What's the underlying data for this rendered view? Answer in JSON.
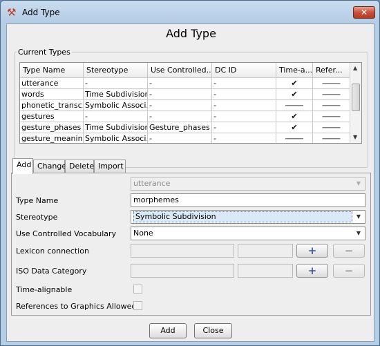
{
  "window": {
    "title": "Add Type",
    "close_glyph": "✕"
  },
  "dialog": {
    "heading": "Add Type"
  },
  "current_types": {
    "group_label": "Current Types",
    "columns": [
      "Type Name",
      "Stereotype",
      "Use Controlled...",
      "DC ID",
      "Time-a...",
      "Refer..."
    ],
    "rows": [
      [
        "utterance",
        "-",
        "-",
        "-",
        "✔",
        "⸻"
      ],
      [
        "words",
        "Time Subdivision",
        "-",
        "-",
        "✔",
        "⸻"
      ],
      [
        "phonetic_transc...",
        "Symbolic Associ...",
        "-",
        "-",
        "⸻",
        "⸻"
      ],
      [
        "gestures",
        "-",
        "-",
        "-",
        "✔",
        "⸻"
      ],
      [
        "gesture_phases",
        "Time Subdivision",
        "Gesture_phases",
        "-",
        "✔",
        "⸻"
      ],
      [
        "gesture_meaning",
        "Symbolic Associ...",
        "-",
        "-",
        "⸻",
        "⸻"
      ]
    ]
  },
  "tabs": [
    {
      "label": "Add",
      "active": true
    },
    {
      "label": "Change",
      "active": false
    },
    {
      "label": "Delete",
      "active": false
    },
    {
      "label": "Import",
      "active": false
    }
  ],
  "form": {
    "parent_value": "utterance",
    "type_name_label": "Type Name",
    "type_name_value": "morphemes",
    "stereotype_label": "Stereotype",
    "stereotype_value": "Symbolic Subdivision",
    "cv_label": "Use Controlled Vocabulary",
    "cv_value": "None",
    "lexicon_label": "Lexicon connection",
    "iso_label": "ISO Data Category",
    "time_alignable_label": "Time-alignable",
    "graphics_label": "References to Graphics Allowed",
    "plus_glyph": "+",
    "minus_glyph": "−"
  },
  "footer": {
    "add_label": "Add",
    "close_label": "Close"
  },
  "icons": {
    "app": "elan-app-icon",
    "dropdown": "chevron-down-icon",
    "scroll_up": "arrow-up-icon",
    "scroll_down": "arrow-down-icon"
  }
}
